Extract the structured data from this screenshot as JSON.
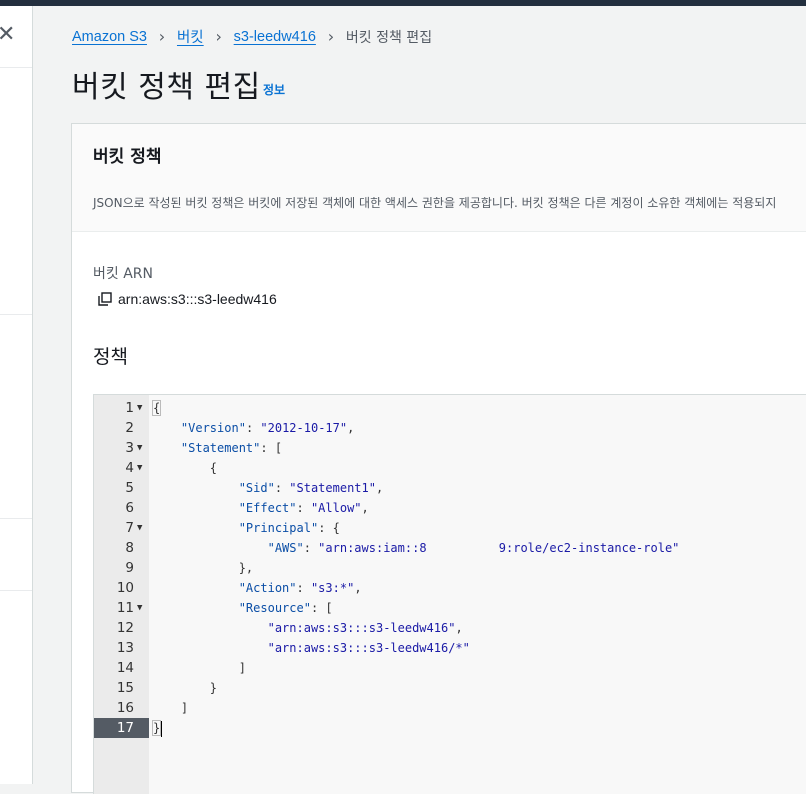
{
  "breadcrumb": {
    "items": [
      "Amazon S3",
      "버킷",
      "s3-leedw416"
    ],
    "current": "버킷 정책 편집"
  },
  "page": {
    "title": "버킷 정책 편집",
    "info": "정보"
  },
  "panel": {
    "title": "버킷 정책",
    "description": "JSON으로 작성된 버킷 정책은 버킷에 저장된 객체에 대한 액세스 권한을 제공합니다. 버킷 정책은 다른 계정이 소유한 객체에는 적용되지",
    "arn_label": "버킷 ARN",
    "arn_value": "arn:aws:s3:::s3-leedw416",
    "policy_label": "정책"
  },
  "editor": {
    "active_line": 17,
    "lines": [
      {
        "n": "1",
        "fold": true,
        "text": "{"
      },
      {
        "n": "2",
        "fold": false,
        "text": "    \"Version\": \"2012-10-17\","
      },
      {
        "n": "3",
        "fold": true,
        "text": "    \"Statement\": ["
      },
      {
        "n": "4",
        "fold": true,
        "text": "        {"
      },
      {
        "n": "5",
        "fold": false,
        "text": "            \"Sid\": \"Statement1\","
      },
      {
        "n": "6",
        "fold": false,
        "text": "            \"Effect\": \"Allow\","
      },
      {
        "n": "7",
        "fold": true,
        "text": "            \"Principal\": {"
      },
      {
        "n": "8",
        "fold": false,
        "text": "                \"AWS\": \"arn:aws:iam::8          9:role/ec2-instance-role\""
      },
      {
        "n": "9",
        "fold": false,
        "text": "            },"
      },
      {
        "n": "10",
        "fold": false,
        "text": "            \"Action\": \"s3:*\","
      },
      {
        "n": "11",
        "fold": true,
        "text": "            \"Resource\": ["
      },
      {
        "n": "12",
        "fold": false,
        "text": "                \"arn:aws:s3:::s3-leedw416\","
      },
      {
        "n": "13",
        "fold": false,
        "text": "                \"arn:aws:s3:::s3-leedw416/*\""
      },
      {
        "n": "14",
        "fold": false,
        "text": "            ]"
      },
      {
        "n": "15",
        "fold": false,
        "text": "        }"
      },
      {
        "n": "16",
        "fold": false,
        "text": "    ]"
      },
      {
        "n": "17",
        "fold": false,
        "text": "}"
      }
    ]
  },
  "icons": {
    "close": "close-icon",
    "copy": "copy-icon",
    "fold": "fold-arrow-icon",
    "chevron": "chevron-right-icon"
  },
  "colors": {
    "link": "#0972d3",
    "topbar": "#232f3e",
    "active_line_bg": "#545b64"
  }
}
